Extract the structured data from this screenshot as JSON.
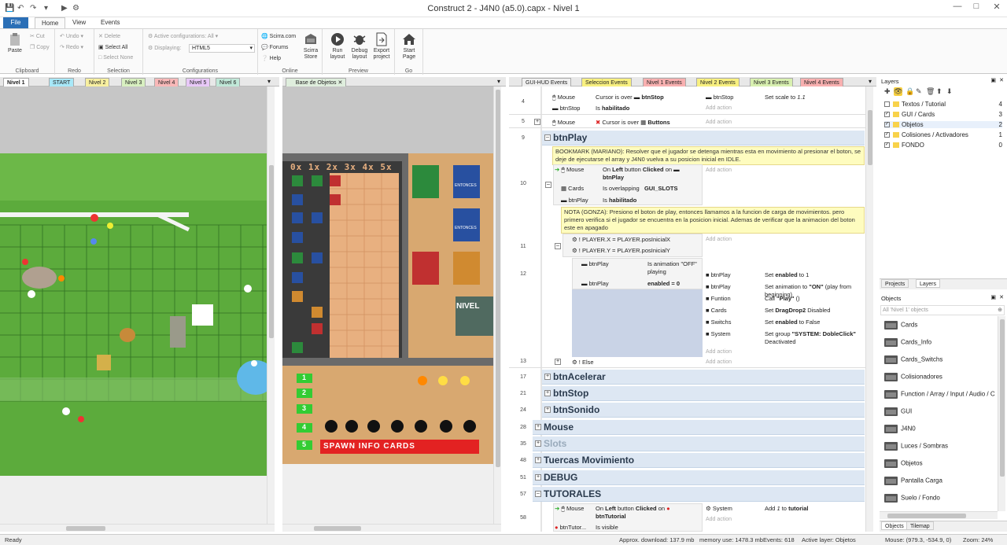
{
  "title": "Construct 2 - J4N0 (a5.0).capx - Nivel 1",
  "ribbon_tabs": {
    "file": "File",
    "home": "Home",
    "view": "View",
    "events": "Events"
  },
  "clipboard": {
    "paste": "Paste",
    "cut": "Cut",
    "copy": "Copy",
    "label": "Clipboard"
  },
  "redo_group": {
    "undo": "Undo",
    "redo": "Redo",
    "label": "Redo"
  },
  "selection": {
    "delete": "Delete",
    "select_all": "Select All",
    "select_none": "Select None",
    "label": "Selection"
  },
  "configurations": {
    "active": "Active configurations: All",
    "displaying_label": "Displaying:",
    "displaying_value": "HTML5",
    "label": "Configurations"
  },
  "online": {
    "scirra": "Scirra.com",
    "forums": "Forums",
    "help": "Help",
    "store": "Scirra Store",
    "label": "Online"
  },
  "preview": {
    "run": "Run layout",
    "debug": "Debug layout",
    "export": "Export project",
    "label": "Preview"
  },
  "go": {
    "start": "Start Page",
    "label": "Go"
  },
  "layout_tabs": [
    "Nivel 1",
    "START",
    "Nivel 2",
    "Nivel 3",
    "Nivel 4",
    "Nivel 5",
    "Nivel 6"
  ],
  "layout_tab_colors": [
    "#ffffff",
    "#a8e8f8",
    "#f8f0a0",
    "#d8f0c0",
    "#f8b8b8",
    "#e8c8f8",
    "#c0e8d8"
  ],
  "base_tab": "Base de Objetos",
  "game": {
    "slot_header": "0x 1x 2x 3x 4x 5x",
    "nivel": "NIVEL",
    "entonces": "ENTONCES",
    "spawn": "SPAWN INFO CARDS",
    "numbers": [
      "1",
      "2",
      "3",
      "4",
      "5"
    ]
  },
  "event_tabs": [
    "GUI-HUD Events",
    "Seleccion Events",
    "Nivel 1 Events",
    "Nivel 2 Events",
    "Nivel 3 Events",
    "Nivel 4 Events"
  ],
  "event_tab_colors": [
    "#f0f0f0",
    "#f8f080",
    "#f8b0b0",
    "#f8f080",
    "#d8f0b0",
    "#f8b0b0"
  ],
  "events": {
    "e4": {
      "num": "4",
      "c1_obj": "Mouse",
      "c1_text": "Cursor is over",
      "c1_target": "btnStop",
      "c2_obj": "btnStop",
      "c2_text": "Is",
      "c2_bold": "habilitado",
      "a1_obj": "btnStop",
      "a1_text": "Set scale to",
      "a1_val": "1.1"
    },
    "e5": {
      "num": "5",
      "obj": "Mouse",
      "text": "Cursor is over",
      "target": "Buttons"
    },
    "g9": {
      "num": "9",
      "title": "btnPlay"
    },
    "bookmark": "BOOKMARK (MARIANO): Resolver que el jugador se detenga mientras esta en movimiento al presionar el boton, se deje de ejecutarse el array y J4N0 vuelva a su posicion inicial en IDLE.",
    "e10": {
      "num": "10",
      "c1_obj": "Mouse",
      "c1_a": "On",
      "c1_b": "Left",
      "c1_c": "button",
      "c1_d": "Clicked",
      "c1_e": "on",
      "c1_target": "btnPlay",
      "c2_obj": "Cards",
      "c2_text": "Is overlapping",
      "c2_target": "GUI_SLOTS",
      "c3_obj": "btnPlay",
      "c3_text": "Is",
      "c3_bold": "habilitado"
    },
    "nota": "NOTA (GONZA): Presiono el boton de play, entonces llamamos a la funcion de carga de movimientos. pero primero verifica si el jugador se encuentra en la posicion inicial. Ademas de verificar que la animacion del boton este en apagado",
    "e11": {
      "num": "11",
      "l1": "PLAYER.X = PLAYER.posInicialX",
      "l2": "PLAYER.Y = PLAYER.posInicialY"
    },
    "e12": {
      "num": "12",
      "c1_obj": "btnPlay",
      "c1_text": "Is animation \"OFF\" playing",
      "c2_obj": "btnPlay",
      "c2_text": "enabled = 0",
      "actions": [
        {
          "obj": "btnPlay",
          "text": "Set",
          "bold": "enabled",
          "rest": "to 1"
        },
        {
          "obj": "btnPlay",
          "text": "Set animation to",
          "bold": "\"ON\"",
          "rest": "(play from beginning)"
        },
        {
          "obj": "Funtion",
          "text": "Call",
          "bold": "\"Play\"",
          "rest": "()"
        },
        {
          "obj": "Cards",
          "text": "Set",
          "bold": "DragDrop2",
          "rest": "Disabled"
        },
        {
          "obj": "Switchs",
          "text": "Set",
          "bold": "enabled",
          "rest": "to False"
        },
        {
          "obj": "System",
          "text": "Set group",
          "bold": "\"SYSTEM: DobleClick\"",
          "rest": "Deactivated"
        }
      ]
    },
    "e13": {
      "num": "13",
      "text": "Else"
    },
    "groups": [
      {
        "num": "17",
        "title": "btnAcelerar"
      },
      {
        "num": "21",
        "title": "btnStop"
      },
      {
        "num": "24",
        "title": "btnSonido"
      },
      {
        "num": "28",
        "title": "Mouse"
      },
      {
        "num": "35",
        "title": "Slots"
      },
      {
        "num": "48",
        "title": "Tuercas Movimiento"
      },
      {
        "num": "51",
        "title": "DEBUG"
      },
      {
        "num": "57",
        "title": "TUTORALES"
      }
    ],
    "e58": {
      "num": "58",
      "c1_obj": "Mouse",
      "c1_a": "On",
      "c1_b": "Left",
      "c1_c": "button",
      "c1_d": "Clicked",
      "c1_e": "on",
      "c1_target": "btnTutorial",
      "c2_obj": "btnTutor...",
      "c2_text": "Is visible",
      "a_obj": "System",
      "a_text": "Add",
      "a_val": "1",
      "a_rest": "to",
      "a_bold": "tutorial"
    },
    "add_action": "Add action"
  },
  "layers": {
    "header": "Layers",
    "items": [
      {
        "name": "Textos / Tutorial",
        "count": "4",
        "checked": false
      },
      {
        "name": "GUI / Cards",
        "count": "3",
        "checked": true
      },
      {
        "name": "Objetos",
        "count": "2",
        "checked": true
      },
      {
        "name": "Colisiones / Activadores",
        "count": "1",
        "checked": true
      },
      {
        "name": "FONDO",
        "count": "0",
        "checked": true
      }
    ],
    "tab_projects": "Projects",
    "tab_layers": "Layers"
  },
  "objects": {
    "header": "Objects",
    "filter": "All 'Nivel 1' objects",
    "items": [
      "Cards",
      "Cards_Info",
      "Cards_Switchs",
      "Colisionadores",
      "Function / Array / Input / Audio / C",
      "GUI",
      "J4N0",
      "Luces / Sombras",
      "Objetos",
      "Pantalla Carga",
      "Suelo / Fondo"
    ],
    "tab_objects": "Objects",
    "tab_tilemap": "Tilemap"
  },
  "status": {
    "ready": "Ready",
    "download": "Approx. download: 137.9 mb",
    "memory": "memory use: 1478.3 mb",
    "events": "Events: 618",
    "layer": "Active layer: Objetos",
    "mouse": "Mouse: (979.3, -534.9, 0)",
    "zoom": "Zoom: 24%"
  }
}
